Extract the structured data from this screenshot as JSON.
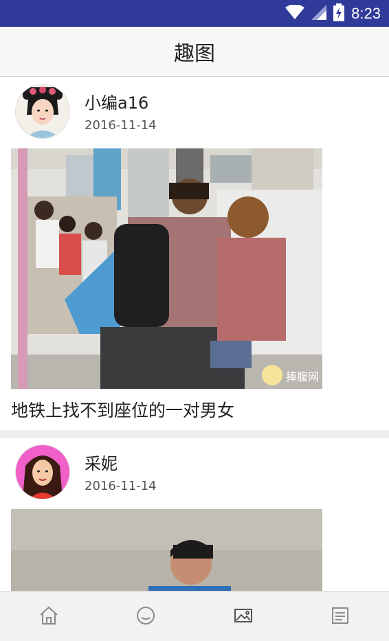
{
  "status_bar": {
    "time": "8:23"
  },
  "header": {
    "title": "趣图"
  },
  "posts": [
    {
      "author": "小编a16",
      "date": "2016-11-14",
      "caption": "地铁上找不到座位的一对男女",
      "watermark": "捧腹网"
    },
    {
      "author": "采妮",
      "date": "2016-11-14"
    }
  ],
  "bottom_nav": [
    {
      "icon": "home-icon"
    },
    {
      "icon": "chat-icon"
    },
    {
      "icon": "image-icon"
    },
    {
      "icon": "list-icon"
    }
  ],
  "colors": {
    "status_bar": "#2f3a99",
    "title_bar": "#f7f7f7",
    "nav_bar": "#f2f2f2",
    "icon_gray": "#8a8a8a"
  }
}
